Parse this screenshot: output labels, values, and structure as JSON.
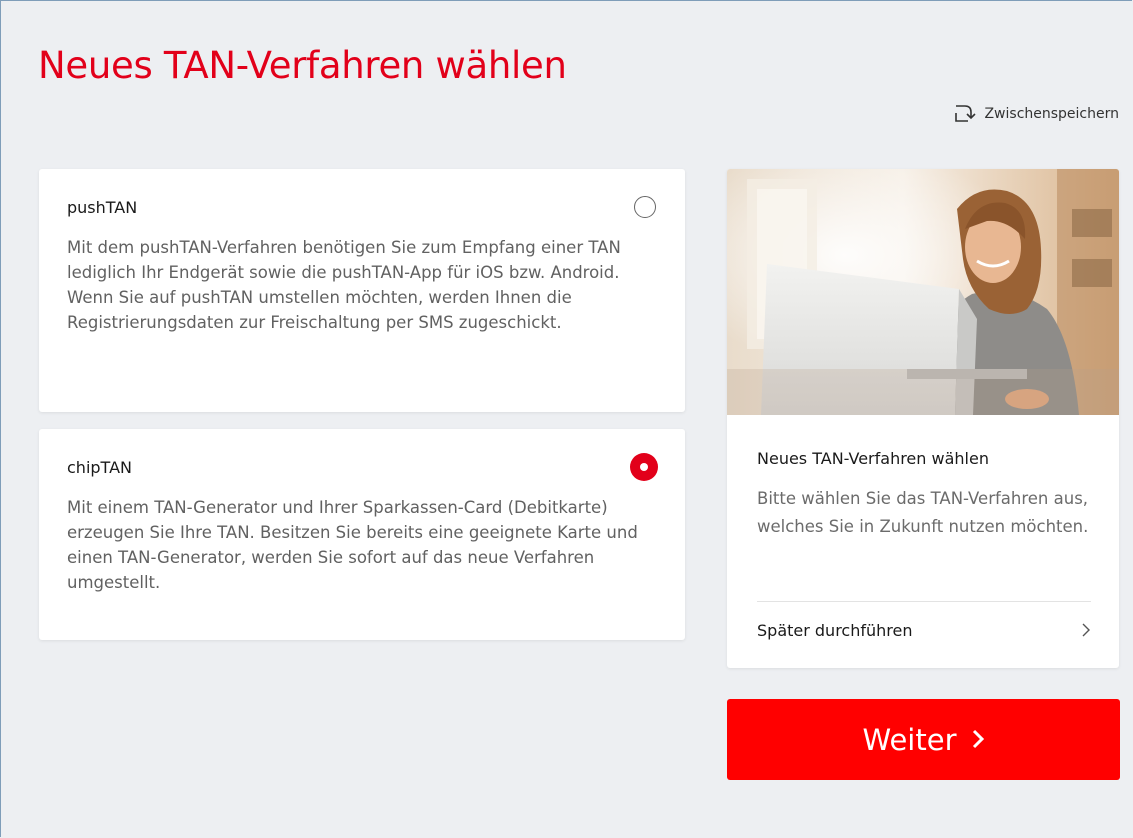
{
  "page": {
    "title": "Neues TAN-Verfahren wählen",
    "save_label": "Zwischenspeichern"
  },
  "options": [
    {
      "title": "pushTAN",
      "description": "Mit dem pushTAN-Verfahren benötigen Sie zum Empfang einer TAN lediglich Ihr Endgerät sowie die pushTAN-App für iOS bzw. Android. Wenn Sie auf pushTAN umstellen möchten, werden Ihnen die Registrierungsdaten zur Freischaltung per SMS zugeschickt.",
      "selected": false
    },
    {
      "title": "chipTAN",
      "description": "Mit einem TAN-Generator und Ihrer Sparkassen-Card (Debitkarte) erzeugen Sie Ihre TAN. Besitzen Sie bereits eine geeignete Karte und einen TAN-Generator, werden Sie sofort auf das neue Verfahren umgestellt.",
      "selected": true
    }
  ],
  "info": {
    "title": "Neues TAN-Verfahren wählen",
    "text": "Bitte wählen Sie das TAN-Verfahren aus, welches Sie in Zukunft nutzen möchten.",
    "later_label": "Später durchführen"
  },
  "next_button": {
    "label": "Weiter"
  },
  "colors": {
    "brand_red": "#e2001a",
    "button_red": "#ff0000",
    "background": "#edeff2"
  },
  "icons": {
    "save": "save-download-icon",
    "later": "chevron-right-icon",
    "next": "chevron-right-icon"
  }
}
